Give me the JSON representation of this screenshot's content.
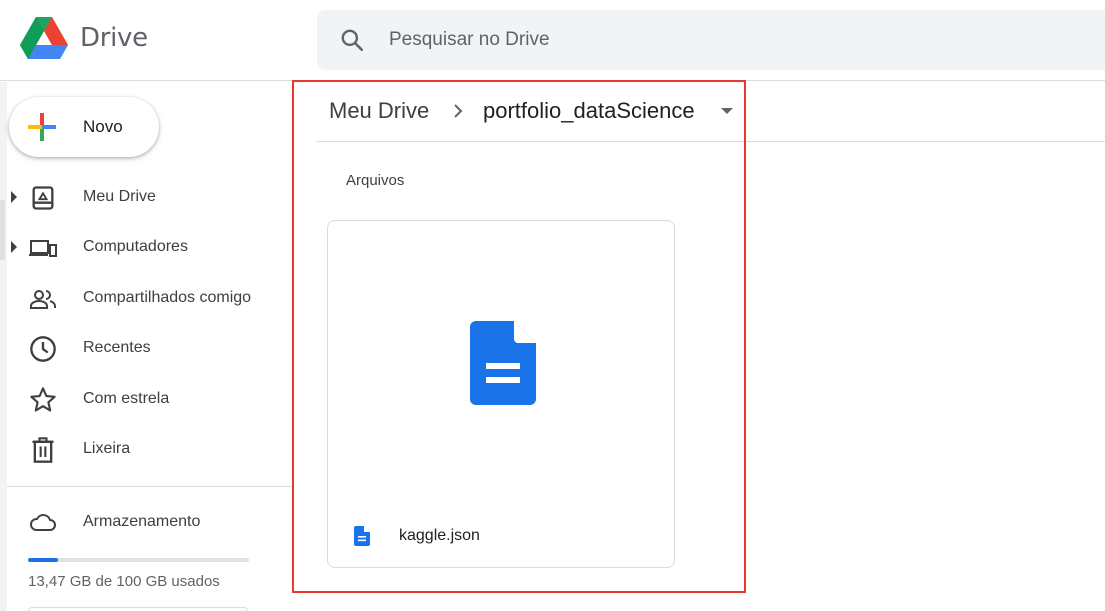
{
  "header": {
    "brand": "Drive",
    "search_placeholder": "Pesquisar no Drive"
  },
  "new_button": {
    "label": "Novo"
  },
  "sidebar": {
    "items": [
      {
        "label": "Meu Drive",
        "icon": "my-drive-icon",
        "expandable": true
      },
      {
        "label": "Computadores",
        "icon": "computers-icon",
        "expandable": true
      },
      {
        "label": "Compartilhados comigo",
        "icon": "shared-people-icon",
        "expandable": false
      },
      {
        "label": "Recentes",
        "icon": "clock-icon",
        "expandable": false
      },
      {
        "label": "Com estrela",
        "icon": "star-icon",
        "expandable": false
      },
      {
        "label": "Lixeira",
        "icon": "trash-icon",
        "expandable": false
      }
    ],
    "storage": {
      "label": "Armazenamento",
      "icon": "cloud-icon",
      "usage_text": "13,47 GB de 100 GB usados",
      "used_fraction": 0.1347
    }
  },
  "breadcrumb": {
    "root": "Meu Drive",
    "current": "portfolio_dataScience"
  },
  "main": {
    "section_title": "Arquivos",
    "files": [
      {
        "name": "kaggle.json",
        "icon": "docs-icon"
      }
    ]
  },
  "colors": {
    "accent_blue": "#1a73e8",
    "docs_blue": "#1a73e8",
    "highlight_red": "#e8392f",
    "search_bg": "#f1f3f4"
  }
}
